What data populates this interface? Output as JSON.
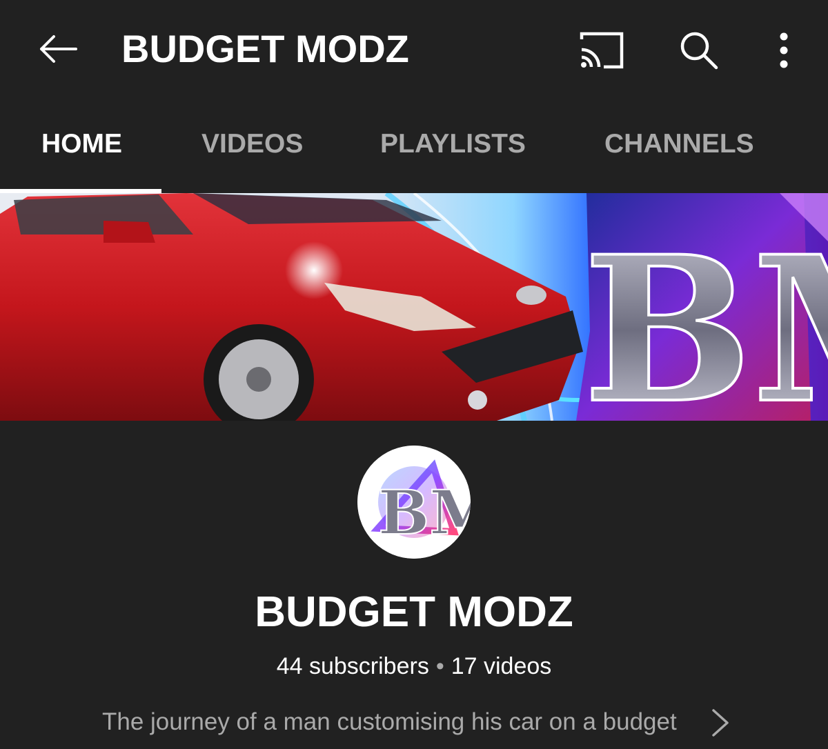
{
  "header": {
    "title": "BUDGET MODZ",
    "back_icon": "arrow-left-icon",
    "cast_icon": "cast-icon",
    "search_icon": "search-icon",
    "more_icon": "more-vertical-icon"
  },
  "tabs": [
    {
      "label": "HOME",
      "active": true
    },
    {
      "label": "VIDEOS",
      "active": false
    },
    {
      "label": "PLAYLISTS",
      "active": false
    },
    {
      "label": "CHANNELS",
      "active": false
    }
  ],
  "banner": {
    "logo_text": "BM"
  },
  "channel": {
    "avatar_text": "BM",
    "name": "BUDGET MODZ",
    "subscribers": "44 subscribers",
    "separator": "•",
    "videos": "17 videos",
    "description": "The journey of a man customising his car on a budget"
  },
  "colors": {
    "background": "#212121",
    "text_primary": "#ffffff",
    "text_secondary": "#aaaaaa",
    "car_red": "#c4161c"
  }
}
